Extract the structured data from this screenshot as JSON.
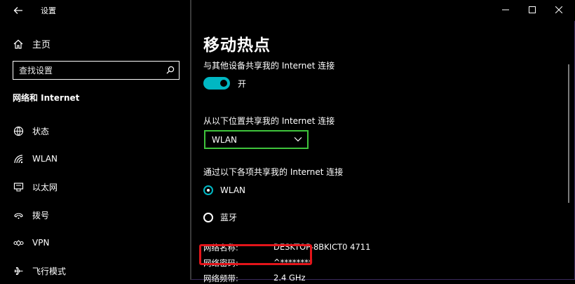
{
  "window": {
    "title": "设置"
  },
  "sidebar": {
    "home_label": "主页",
    "search_placeholder": "查找设置",
    "section_title": "网络和 Internet",
    "items": [
      {
        "label": "状态",
        "icon": "status-icon"
      },
      {
        "label": "WLAN",
        "icon": "wifi-icon"
      },
      {
        "label": "以太网",
        "icon": "ethernet-icon"
      },
      {
        "label": "拨号",
        "icon": "dialup-icon"
      },
      {
        "label": "VPN",
        "icon": "vpn-icon"
      },
      {
        "label": "飞行模式",
        "icon": "airplane-icon"
      }
    ]
  },
  "main": {
    "title": "移动热点",
    "share_label": "与其他设备共享我的 Internet 连接",
    "toggle_state": "开",
    "share_from_label": "从以下位置共享我的 Internet 连接",
    "share_from_value": "WLAN",
    "share_over_label": "通过以下各项共享我的 Internet 连接",
    "share_over_options": [
      {
        "label": "WLAN",
        "selected": true
      },
      {
        "label": "蓝牙",
        "selected": false
      }
    ],
    "properties": [
      {
        "label": "网络名称:",
        "value": "DESKTOP-8BKICT0 4711"
      },
      {
        "label": "网络密码:",
        "value": "^********"
      },
      {
        "label": "网络频带:",
        "value": "2.4 GHz"
      }
    ]
  },
  "colors": {
    "accent": "#00b7c3",
    "select_border": "#3fc43c",
    "highlight": "#e3151a"
  }
}
